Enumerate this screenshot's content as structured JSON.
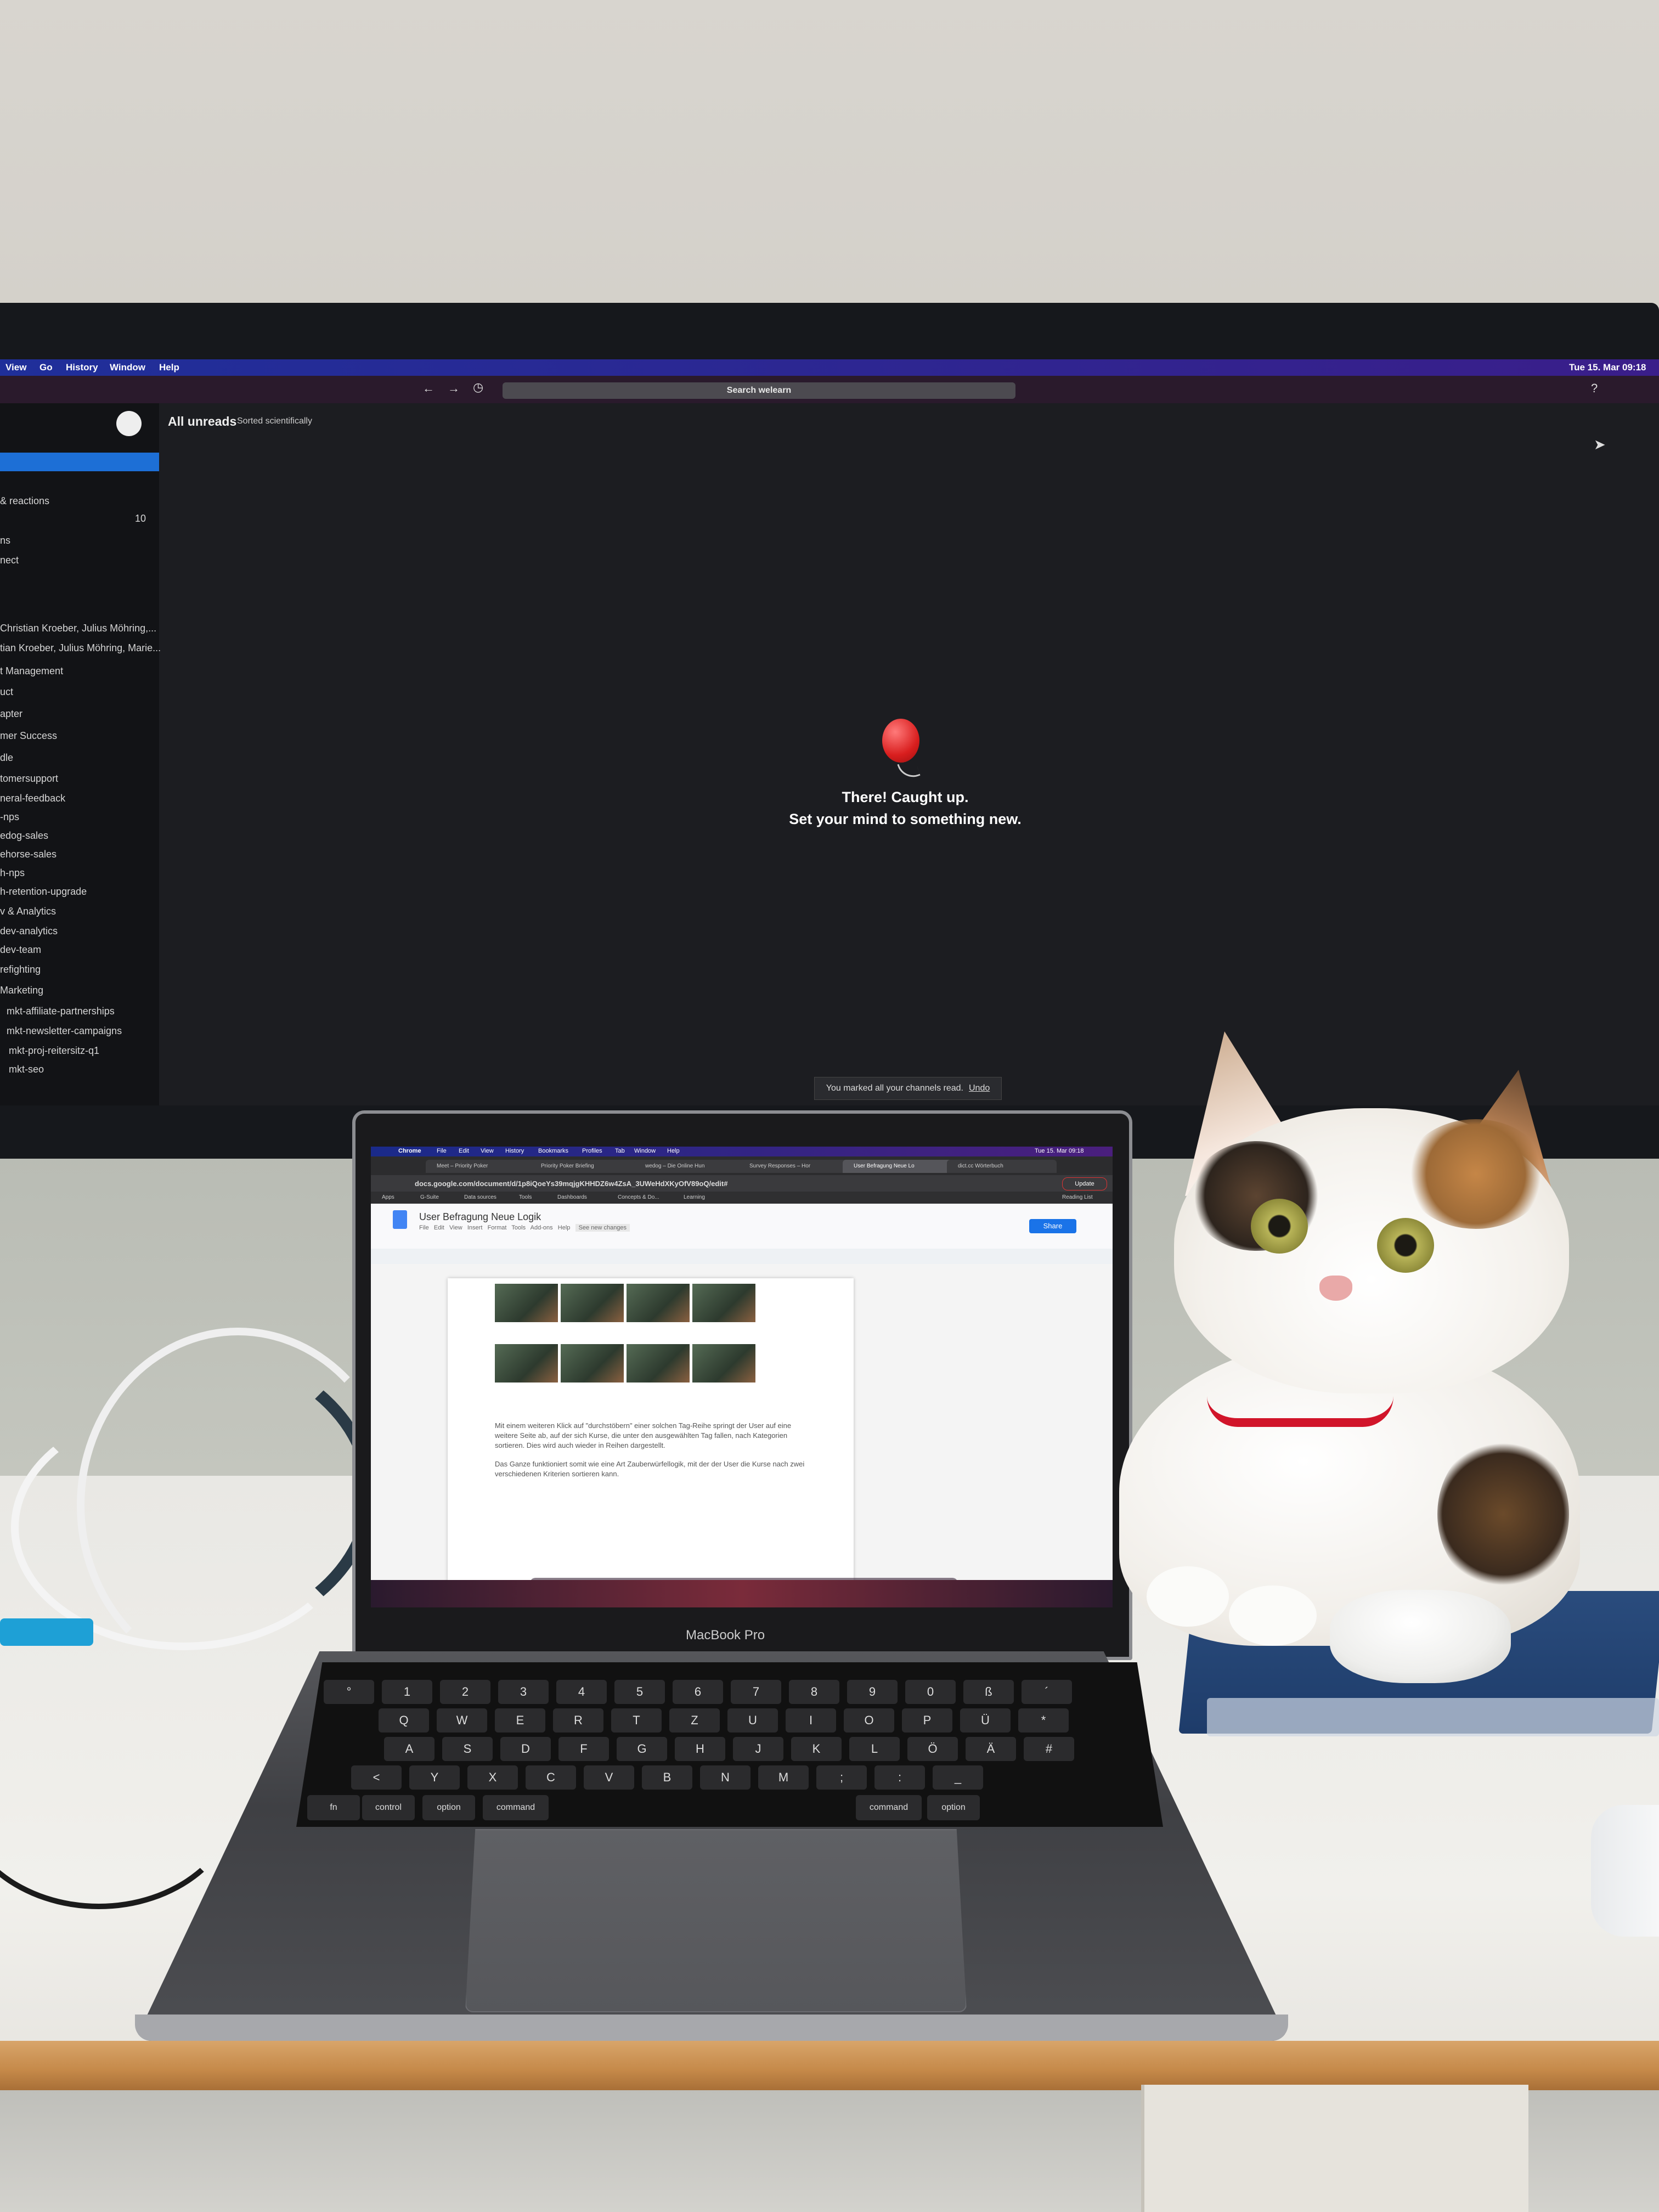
{
  "monitor": {
    "menubar": {
      "items": [
        "View",
        "Go",
        "History",
        "Window",
        "Help"
      ],
      "clock": "Tue 15. Mar 09:18"
    },
    "search_placeholder": "Search welearn",
    "main": {
      "title": "All unreads",
      "sort": "Sorted scientifically",
      "message_line1": "There! Caught up.",
      "message_line2": "Set your mind to something new."
    },
    "toast": {
      "text": "You marked all your channels read.",
      "undo": "Undo"
    },
    "sidebar": {
      "badge": "10",
      "items": [
        "& reactions",
        "ns",
        "nect",
        "Christian Kroeber, Julius Möhring,...",
        "tian Kroeber, Julius Möhring, Marie...",
        "t Management",
        "uct",
        "apter",
        "mer Success",
        "dle",
        "tomersupport",
        "neral-feedback",
        "-nps",
        "edog-sales",
        "ehorse-sales",
        "h-nps",
        "h-retention-upgrade",
        "v & Analytics",
        "dev-analytics",
        "dev-team",
        "refighting",
        "Marketing",
        "mkt-affiliate-partnerships",
        "mkt-newsletter-campaigns",
        "mkt-proj-reitersitz-q1",
        "mkt-seo"
      ]
    }
  },
  "laptop": {
    "menubar": [
      "Chrome",
      "File",
      "Edit",
      "View",
      "History",
      "Bookmarks",
      "Profiles",
      "Tab",
      "Window",
      "Help"
    ],
    "clock": "Tue 15. Mar 09:18",
    "tabs": [
      "Meet – Priority Poker",
      "Priority Poker Briefing",
      "wedog – Die Online Hun",
      "Survey Responses – Hor",
      "User Befragung Neue Lo",
      "dict.cc Wörterbuch"
    ],
    "url": "docs.google.com/document/d/1p8iQoeYs39mqjgKHHDZ6w4ZsA_3UWeHdXKyOfV89oQ/edit#",
    "bookmarks": [
      "Apps",
      "G-Suite",
      "Data sources",
      "Tools",
      "Dashboards",
      "Concepts & Do...",
      "Learning",
      "Reading List"
    ],
    "doc": {
      "title": "User Befragung Neue Logik",
      "menu": [
        "File",
        "Edit",
        "View",
        "Insert",
        "Format",
        "Tools",
        "Add-ons",
        "Help"
      ],
      "changes": "See new changes",
      "share": "Share",
      "update": "Update",
      "paragraph1": "Mit einem weiteren Klick auf \"durchstöbern\" einer solchen Tag-Reihe springt der User auf eine weitere Seite ab, auf der sich Kurse, die unter den ausgewählten Tag fallen, nach Kategorien sortieren. Dies wird auch wieder in Reihen dargestellt.",
      "paragraph2": "Das Ganze funktioniert somit wie eine Art Zauberwürfellogik, mit der der User die Kurse nach zwei verschiedenen Kriterien sortieren kann."
    },
    "brand": "MacBook Pro",
    "keys": {
      "row1": [
        "°",
        "1",
        "2",
        "3",
        "4",
        "5",
        "6",
        "7",
        "8",
        "9",
        "0",
        "ß",
        "´"
      ],
      "row2": [
        "Q",
        "W",
        "E",
        "R",
        "T",
        "Z",
        "U",
        "I",
        "O",
        "P",
        "Ü",
        "*"
      ],
      "row3": [
        "A",
        "S",
        "D",
        "F",
        "G",
        "H",
        "J",
        "K",
        "L",
        "Ö",
        "Ä",
        "#"
      ],
      "row4": [
        "<",
        "Y",
        "X",
        "C",
        "V",
        "B",
        "N",
        "M",
        ";",
        ":",
        "_"
      ],
      "modifiers": [
        "fn",
        "control",
        "option",
        "command",
        "command",
        "option"
      ]
    }
  },
  "colors": {
    "monitor_accent": "#1d6fd6",
    "collar": "#d1152a",
    "balloon": "#d91e1e",
    "share_button": "#1a73e8"
  }
}
